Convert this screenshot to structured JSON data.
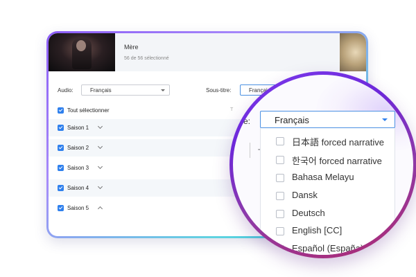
{
  "movie": {
    "title": "Mère",
    "subtitle": "56 de 56 sélectionné"
  },
  "audio": {
    "label": "Audio:",
    "value": "Français"
  },
  "subtitles": {
    "label": "Sous-titre:",
    "value": "Françai"
  },
  "select_all": {
    "label": "Tout sélectionner",
    "column_hint": "T"
  },
  "seasons": [
    {
      "label": "Saison 1",
      "expanded": false
    },
    {
      "label": "Saison 2",
      "expanded": false
    },
    {
      "label": "Saison 3",
      "expanded": false
    },
    {
      "label": "Saison 4",
      "expanded": false
    },
    {
      "label": "Saison 5",
      "expanded": true
    }
  ],
  "magnifier": {
    "label": "e:",
    "selected": "Français",
    "background_text": "T",
    "options": [
      {
        "label": "日本語 forced narrative"
      },
      {
        "label": "한국어 forced narrative"
      },
      {
        "label": "Bahasa Melayu"
      },
      {
        "label": "Dansk"
      },
      {
        "label": "Deutsch"
      },
      {
        "label": "English [CC]"
      },
      {
        "label": "Español (España)"
      }
    ]
  },
  "colors": {
    "accent": "#2f80ed",
    "ring_start": "#7c3aed",
    "ring_end": "#b02a6e",
    "card_border_start": "#8b5cf6",
    "card_border_end": "#2ec7d8"
  }
}
